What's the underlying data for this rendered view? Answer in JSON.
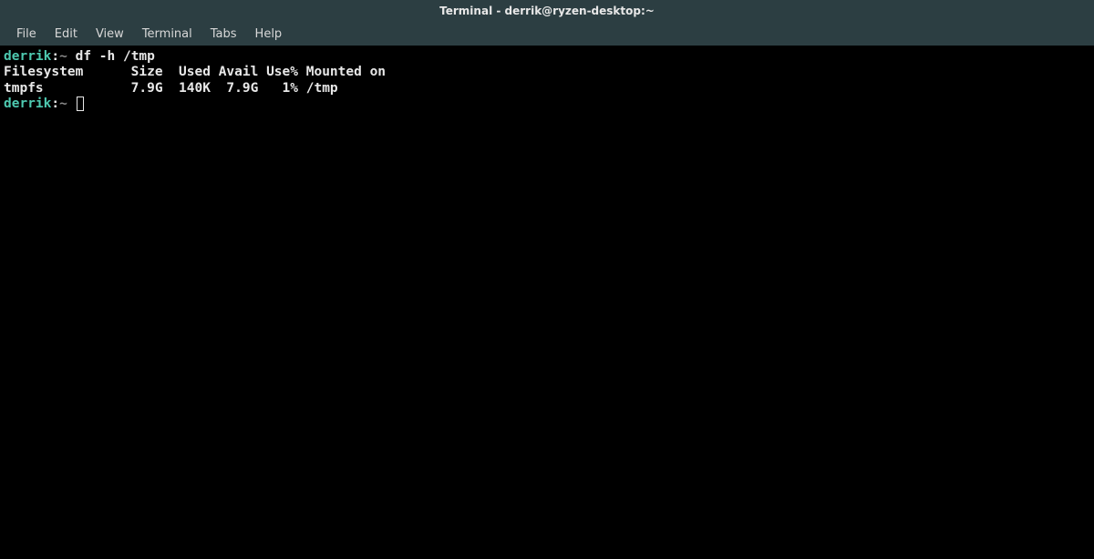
{
  "window": {
    "title": "Terminal - derrik@ryzen-desktop:~"
  },
  "menu": {
    "file": "File",
    "edit": "Edit",
    "view": "View",
    "terminal": "Terminal",
    "tabs": "Tabs",
    "help": "Help"
  },
  "terminal": {
    "prompt_user": "derrik",
    "prompt_colon": ":",
    "prompt_tilde": "~",
    "command1": "df -h /tmp",
    "output_header": "Filesystem      Size  Used Avail Use% Mounted on",
    "output_row": "tmpfs           7.9G  140K  7.9G   1% /tmp",
    "prompt2_user": "derrik",
    "prompt2_colon": ":",
    "prompt2_tilde": "~"
  }
}
